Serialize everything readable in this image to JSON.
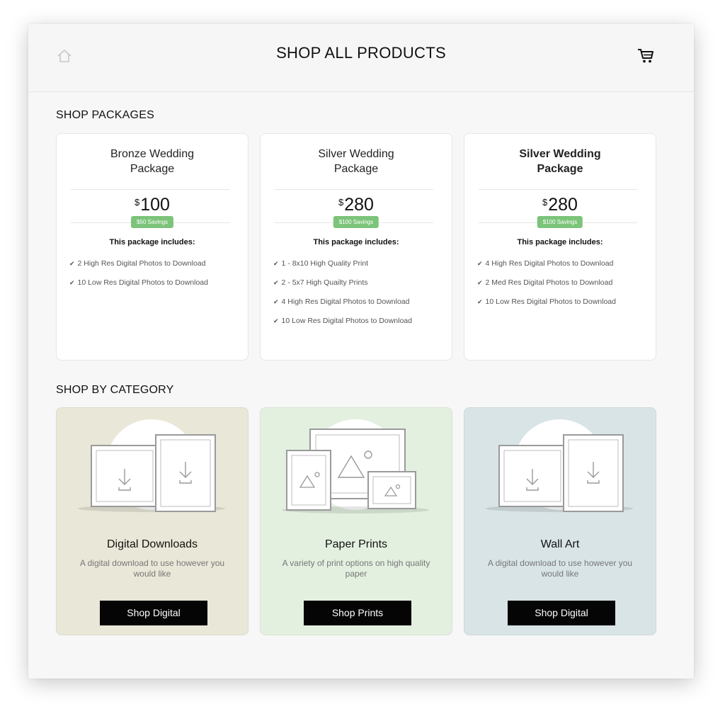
{
  "header": {
    "title": "SHOP ALL PRODUCTS",
    "home_icon": "home-icon",
    "cart_icon": "shopping-cart-icon"
  },
  "packages_section": {
    "title": "SHOP PACKAGES",
    "includes_label": "This package includes:",
    "currency": "$",
    "accent_color": "#7cc47a",
    "items": [
      {
        "name": "Bronze Wedding\nPackage",
        "price": "100",
        "savings": "$50 Savings",
        "features": [
          "2 High Res Digital Photos to Download",
          "10 Low Res Digital Photos to Download"
        ]
      },
      {
        "name": "Silver Wedding\nPackage",
        "price": "280",
        "savings": "$100 Savings",
        "features": [
          "1 - 8x10 High Quality Print",
          "2 - 5x7 High Quailty Prints",
          "4 High Res Digital Photos to Download",
          "10 Low Res Digital Photos to Download"
        ]
      },
      {
        "name": "Silver Wedding\nPackage",
        "price": "280",
        "savings": "$100 Savings",
        "features": [
          "4 High Res Digital Photos to Download",
          "2 Med Res Digital Photos to Download",
          "10 Low Res Digital Photos to Download"
        ]
      }
    ]
  },
  "category_section": {
    "title": "SHOP BY CATEGORY",
    "items": [
      {
        "name": "Digital Downloads",
        "description": "A digital download to use however you would like",
        "button": "Shop Digital",
        "bg_color": "#e9e7d7",
        "icon": "download-frames-icon"
      },
      {
        "name": "Paper Prints",
        "description": "A variety of print options on high quality paper",
        "button": "Shop Prints",
        "bg_color": "#e3f0e0",
        "icon": "photo-frames-icon"
      },
      {
        "name": "Wall Art",
        "description": "A digital download to use however you would like",
        "button": "Shop Digital",
        "bg_color": "#d9e4e7",
        "icon": "download-frames-icon"
      }
    ]
  }
}
